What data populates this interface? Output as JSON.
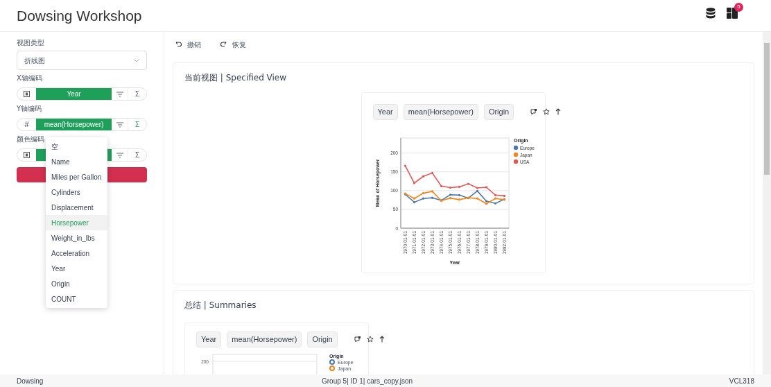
{
  "app": {
    "title": "Dowsing Workshop",
    "notification_badge": "5"
  },
  "sidebar": {
    "view_type": {
      "label": "视图类型",
      "value": "折线图"
    },
    "encodings": [
      {
        "label": "X轴编码",
        "kind": "icon",
        "field": "Year",
        "sigma": "Σ",
        "aggregate": false
      },
      {
        "label": "Y轴编码",
        "kind": "symbol",
        "symbol": "#",
        "field": "mean(Horsepower)",
        "sigma": "Σ",
        "aggregate": true
      },
      {
        "label": "颜色编码",
        "kind": "icon",
        "sigma": "Σ",
        "aggregate": false
      }
    ],
    "dropdown": [
      {
        "label": "空",
        "selected": false
      },
      {
        "label": "Name",
        "selected": false
      },
      {
        "label": "Miles per Gallon",
        "selected": false
      },
      {
        "label": "Cylinders",
        "selected": false
      },
      {
        "label": "Displacement",
        "selected": false
      },
      {
        "label": "Horsepower",
        "selected": true
      },
      {
        "label": "Weight_in_lbs",
        "selected": false
      },
      {
        "label": "Acceleration",
        "selected": false
      },
      {
        "label": "Year",
        "selected": false
      },
      {
        "label": "Origin",
        "selected": false
      },
      {
        "label": "COUNT",
        "selected": false
      }
    ]
  },
  "toolbar": [
    {
      "kind": "undo",
      "label": "撤销"
    },
    {
      "kind": "redo",
      "label": "恢复"
    }
  ],
  "specified_view": {
    "title": "当前视图 | Specified View",
    "pills": [
      "Year",
      "mean(Horsepower)",
      "Origin"
    ],
    "chart_data": {
      "type": "line",
      "xlabel": "Year",
      "ylabel": "Mean of Horsepower",
      "categories": [
        "1970-01-01",
        "1971-01-01",
        "1972-01-01",
        "1973-01-01",
        "1974-01-01",
        "1975-01-01",
        "1976-01-01",
        "1977-01-01",
        "1978-01-01",
        "1979-01-01",
        "1980-01-01",
        "1982-01-01"
      ],
      "ylim": [
        0,
        240
      ],
      "grid": true,
      "legend": true,
      "yticks": [
        0,
        50,
        100,
        150,
        200
      ],
      "legend_title": "Origin",
      "series": [
        {
          "name": "Europe",
          "color": "#4c78a8",
          "values": [
            90,
            69,
            79,
            81,
            74,
            89,
            88,
            80,
            99,
            72,
            66,
            77
          ]
        },
        {
          "name": "Japan",
          "color": "#f58518",
          "values": [
            92,
            79,
            93,
            98,
            73,
            80,
            76,
            81,
            79,
            65,
            79,
            76
          ]
        },
        {
          "name": "USA",
          "color": "#e45756",
          "values": [
            166,
            120,
            138,
            147,
            112,
            108,
            110,
            118,
            107,
            109,
            88,
            86
          ]
        }
      ]
    }
  },
  "summaries": {
    "title": "总结 | Summaries",
    "pills": [
      "Year",
      "mean(Horsepower)",
      "Origin"
    ],
    "tick": "200",
    "legend_title": "Origin",
    "legend": [
      {
        "label": "Europe",
        "color": "#4c78a8"
      },
      {
        "label": "Japan",
        "color": "#f58518"
      }
    ]
  },
  "status_bar": {
    "left": "Dowsing",
    "center": "Group 5| ID 1| cars_copy.json",
    "right": "VCL318"
  }
}
